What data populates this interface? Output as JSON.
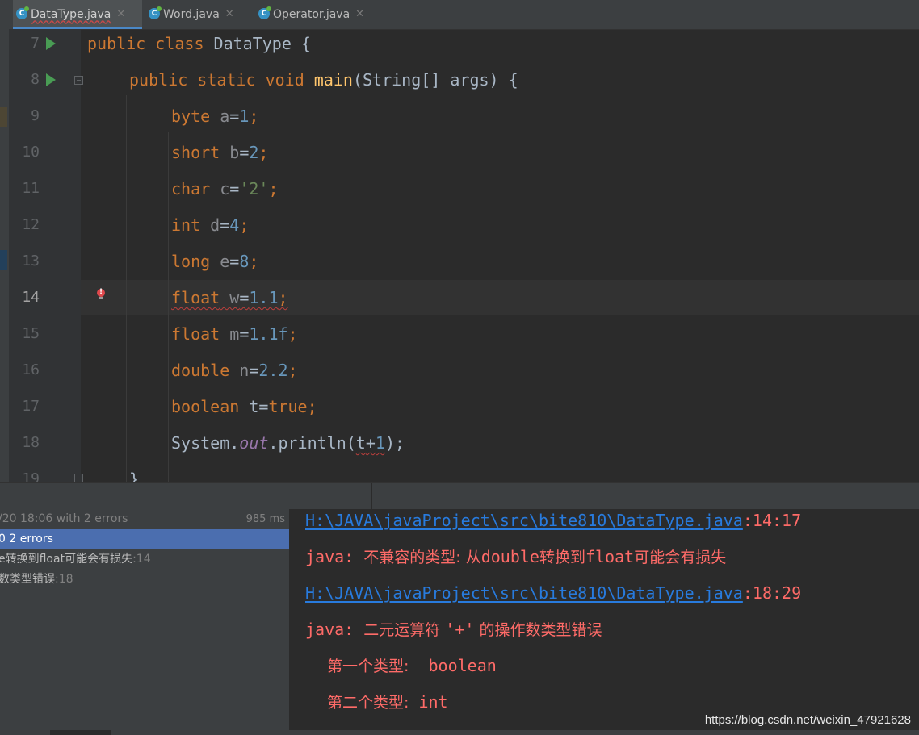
{
  "tabs": [
    {
      "label": "DataType.java",
      "active": true,
      "icon": "java-class-icon"
    },
    {
      "label": "Word.java",
      "active": false,
      "icon": "java-class-icon"
    },
    {
      "label": "Operator.java",
      "active": false,
      "icon": "java-class-icon"
    }
  ],
  "editor": {
    "line_numbers": [
      "7",
      "8",
      "9",
      "10",
      "11",
      "12",
      "13",
      "14",
      "15",
      "16",
      "17",
      "18",
      "19"
    ],
    "current_line": "14",
    "code": {
      "l7": {
        "kw1": "public class ",
        "name": "DataType",
        "rest": " {"
      },
      "l8": {
        "kw1": "public static void ",
        "fn": "main",
        "rest": "(String[] args) {"
      },
      "l9": {
        "type": "byte",
        "var": " a",
        "eq": "=",
        "val": "1",
        "end": ";"
      },
      "l10": {
        "type": "short",
        "var": " b",
        "eq": "=",
        "val": "2",
        "end": ";"
      },
      "l11": {
        "type": "char",
        "var": " c",
        "eq": "=",
        "val": "'2'",
        "end": ";"
      },
      "l12": {
        "type": "int",
        "var": " d",
        "eq": "=",
        "val": "4",
        "end": ";"
      },
      "l13": {
        "type": "long",
        "var": " e",
        "eq": "=",
        "val": "8",
        "end": ";"
      },
      "l14": {
        "type": "float",
        "var": " w",
        "eq": "=",
        "val": "1.1",
        "end": ";"
      },
      "l15": {
        "type": "float",
        "var": " m",
        "eq": "=",
        "val": "1.1f",
        "end": ";"
      },
      "l16": {
        "type": "double",
        "var": " n",
        "eq": "=",
        "val": "2.2",
        "end": ";"
      },
      "l17": {
        "type": "boolean",
        "var": " t",
        "eq": "=",
        "val": "true",
        "end": ";"
      },
      "l18": {
        "cls": "System.",
        "field": "out",
        "call": ".println(",
        "arg_t": "t",
        "plus": "+",
        "arg_1": "1",
        "end": ");"
      },
      "l19": {
        "brace": "}"
      }
    }
  },
  "build_tree": {
    "header": "/20 18:06 with 2 errors",
    "duration": "985 ms",
    "summary": "0 2 errors",
    "items": [
      {
        "text": "e转换到float可能会有损失",
        "line": ":14"
      },
      {
        "text": "数类型错误",
        "line": ":18"
      }
    ]
  },
  "console": {
    "err1_path": "H:\\JAVA\\javaProject\\src\\bite810\\DataType.java",
    "err1_pos": ":14:17",
    "err1_prefix": "java: ",
    "err1_msg_a": "不兼容的类型: 从",
    "err1_msg_b": "double",
    "err1_msg_c": "转换到",
    "err1_msg_d": "float",
    "err1_msg_e": "可能会有损失",
    "err2_path": "H:\\JAVA\\javaProject\\src\\bite810\\DataType.java",
    "err2_pos": ":18:29",
    "err2_prefix": "java: ",
    "err2_msg_a": "二元运算符 ",
    "err2_msg_b": "'+'",
    "err2_msg_c": " 的操作数类型错误",
    "type1_label": "第一个类型:",
    "type1_value": "  boolean",
    "type2_label": "第二个类型:",
    "type2_value": " int"
  },
  "watermark": "https://blog.csdn.net/weixin_47921628",
  "colors": {
    "keyword": "#cc7832",
    "function": "#ffc66d",
    "number": "#6897bb",
    "string": "#6a8759",
    "error": "#ff6b68",
    "link": "#287bde",
    "selection": "#4b6eaf"
  }
}
